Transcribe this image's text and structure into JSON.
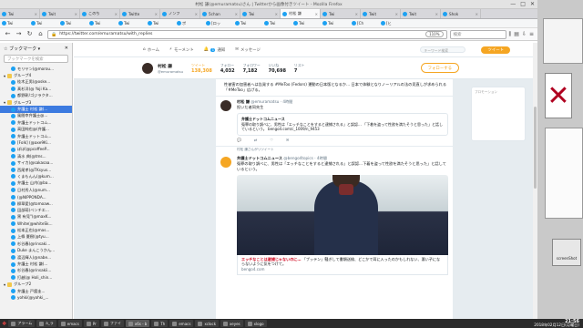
{
  "window": {
    "title": "村松 謙(@emuramatsu)さん | Twitterから画像付きツイート - Mozilla Firefox",
    "controls": [
      "—",
      "□",
      "✕"
    ]
  },
  "tabs": [
    {
      "label": "Twi",
      "active": false
    },
    {
      "label": "Twit",
      "active": false
    },
    {
      "label": "このち",
      "active": false
    },
    {
      "label": "Twitte",
      "active": false
    },
    {
      "label": "ノンフ",
      "active": false
    },
    {
      "label": "5chan",
      "active": false
    },
    {
      "label": "Twi",
      "active": false
    },
    {
      "label": "村松 謙",
      "active": true
    },
    {
      "label": "Twi",
      "active": false
    },
    {
      "label": "Twit",
      "active": false
    },
    {
      "label": "Twit",
      "active": false
    },
    {
      "label": "Shok",
      "active": false
    }
  ],
  "bookmarks": [
    "Twi",
    "Twi",
    "Twi",
    "Twi",
    "Twi",
    "Twi",
    "ポ",
    "[ロッ",
    "Twi",
    "Twi",
    "Twi",
    "Twi",
    "[Ch",
    "[ヒ"
  ],
  "nav": {
    "url": "https://twitter.com/emuramatsu/with_replies",
    "zoom": "110%",
    "search_placeholder": "検索"
  },
  "sidebar": {
    "title": "ブックマーク",
    "search_placeholder": "ブックマークを検索",
    "items": [
      {
        "label": "モリヤン(@morou...",
        "folder": false,
        "selected": false
      },
      {
        "label": "グループ4",
        "folder": true,
        "selected": false
      },
      {
        "label": "桂木正男(@oske...",
        "folder": false,
        "selected": false
      },
      {
        "label": "髙杉洋(@ Yoji Ka...",
        "folder": false,
        "selected": false
      },
      {
        "label": "都野彰/ゴジラクタ...",
        "folder": false,
        "selected": false
      },
      {
        "label": "グループ3",
        "folder": true,
        "selected": false
      },
      {
        "label": "弁護士 村松 謙(...",
        "folder": false,
        "selected": true
      },
      {
        "label": "風間幸弁護士@...",
        "folder": false,
        "selected": false
      },
      {
        "label": "弁護士ドットコム...",
        "folder": false,
        "selected": false
      },
      {
        "label": "高田純也@(弁護...",
        "folder": false,
        "selected": false
      },
      {
        "label": "弁護士ドットコム...",
        "folder": false,
        "selected": false
      },
      {
        "label": "[Folk] (@axe9Ki...",
        "folder": false,
        "selected": false
      },
      {
        "label": "ぽぽ(@pcoffeeP...",
        "folder": false,
        "selected": false
      },
      {
        "label": "清水 典(@tms...",
        "folder": false,
        "selected": false
      },
      {
        "label": "サイカ(@sakasaa...",
        "folder": false,
        "selected": false
      },
      {
        "label": "西尾孝(@TKsyus...",
        "folder": false,
        "selected": false
      },
      {
        "label": "くまもんん(@kum...",
        "folder": false,
        "selected": false
      },
      {
        "label": "弁護士 山内(@ba...",
        "folder": false,
        "selected": false
      },
      {
        "label": "日村秀人(@num...",
        "folder": false,
        "selected": false
      },
      {
        "label": "(@NIPPONDA...",
        "folder": false,
        "selected": false
      },
      {
        "label": "柳翠愛(@tomoaw...",
        "folder": false,
        "selected": false
      },
      {
        "label": "田部萌(ベンチエ...",
        "folder": false,
        "selected": false
      },
      {
        "label": "黒 有見\"(@maxK...",
        "folder": false,
        "selected": false
      },
      {
        "label": "White(@whiteSk...",
        "folder": false,
        "selected": false
      },
      {
        "label": "松本正也(@mas...",
        "folder": false,
        "selected": false
      },
      {
        "label": "上條 夏樹(@tyu...",
        "folder": false,
        "selected": false
      },
      {
        "label": "杉谷春(@rinsaki...",
        "folder": false,
        "selected": false
      },
      {
        "label": "Duke まんこうかん...",
        "folder": false,
        "selected": false
      },
      {
        "label": "渡辺輝人(@nabe...",
        "folder": false,
        "selected": false
      },
      {
        "label": "弁護士 村松 謙(...",
        "folder": false,
        "selected": false
      },
      {
        "label": "杉谷春(@rinsakii...",
        "folder": false,
        "selected": false
      },
      {
        "label": "打越(@ Holi_shin...",
        "folder": false,
        "selected": false
      },
      {
        "label": "グループ2",
        "folder": true,
        "selected": false
      },
      {
        "label": "弁護士 戸舘圭...",
        "folder": false,
        "selected": false
      },
      {
        "label": "yohki(@yohki_...",
        "folder": false,
        "selected": false
      }
    ]
  },
  "twitter": {
    "nav": [
      {
        "label": "ホーム",
        "badge": ""
      },
      {
        "label": "モーメント",
        "badge": ""
      },
      {
        "label": "通知",
        "badge": "1"
      },
      {
        "label": "メッセージ",
        "badge": ""
      }
    ],
    "search_placeholder": "キーワード検索",
    "tweet_button": "ツイート",
    "profile": {
      "name": "村松 謙",
      "handle": "@emuramatsu",
      "stats": [
        {
          "label": "ツイート",
          "value": "138,308",
          "active": true
        },
        {
          "label": "フォロー",
          "value": "4,032",
          "active": false
        },
        {
          "label": "フォロワー",
          "value": "7,182",
          "active": false
        },
        {
          "label": "いいね",
          "value": "70,698",
          "active": false
        },
        {
          "label": "リスト",
          "value": "7",
          "active": false
        }
      ],
      "follow_button": "フォローする"
    },
    "tweets": [
      {
        "retweet": "",
        "name": "",
        "handle": "",
        "time": "",
        "text": "性被害の加害者へは告発する #MeToo (Fedors) 運動の日本版となるか… 日本で体験となりノーリアルの法の見直しが求められる「#MeToo」広げる。",
        "card_title": "",
        "card_text": ""
      },
      {
        "retweet": "",
        "name": "村松 謙",
        "handle": "@emuramatsu",
        "time": "4時間",
        "text": "担いだ者同先生",
        "card_title": "弁護士ドットコムニュース",
        "card_text": "冤罪の取り調べに、男性は「エッチなことをすると逮捕される」と誤認… 「下着を盗って性欲を満たそうと思った」と話しているという。 bengo4.com/c_1009/n_9453"
      },
      {
        "retweet": "村松 謙さんがリツイート",
        "name": "弁護士ドットコムニュース",
        "handle": "@bengo4topics",
        "time": "4時間",
        "text": "冤罪の取り調べに、男性は「エッチなことをすると逮捕される」と誤認…下着を盗って性欲を満たそうと思った」と話しているという。",
        "card_title": "",
        "card_text": ""
      }
    ],
    "photo_caption_red": "エッチなことは逮捕じゃないのに…",
    "photo_caption": "「ブッテン」騒ぎして書類送検、どこかで耳に入ったのかもしれない、悪い子にならないように気をつけて。",
    "photo_domain": "bengo4.com",
    "ad_text": "プロモーション"
  },
  "taskbar": {
    "items": [
      "アラーム",
      "a_ラ",
      "emacs",
      "Pr",
      "ファイ",
      "x6s - b",
      "Th",
      "emacs",
      "xclock",
      "xeyes",
      "xlogo"
    ],
    "time": "21:56",
    "date": "2018年02月12日(月曜日)"
  },
  "bg_windows": {
    "screenshot_label": "screenShot"
  },
  "colors": {
    "twitter_blue": "#1da1f2",
    "accent_orange": "#f5a623",
    "selection": "#3d7be0"
  }
}
